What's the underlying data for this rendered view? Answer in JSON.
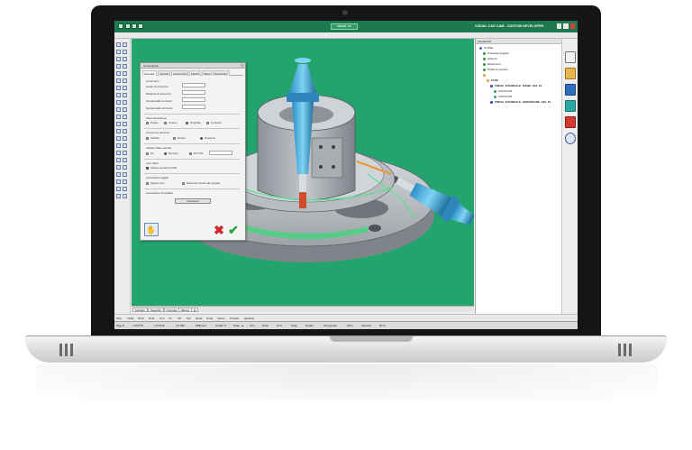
{
  "window": {
    "app_title": "VISUAL CAD CAM - CUSTOM DEVELOPER",
    "logo_text": "VISUAL CC"
  },
  "dialog": {
    "title": "Contornitura",
    "tabs": [
      "Generale",
      "Utensile",
      "Contornitura",
      "Attacco",
      "Stacco",
      "Descrizione"
    ],
    "fields": [
      {
        "label": "Incremento",
        "value": ""
      },
      {
        "label": "Livello di sicurezza",
        "value": ""
      },
      {
        "label": "Distanza di sicurezza",
        "value": ""
      },
      {
        "label": "Sovrametallo sui bordi",
        "value": ""
      },
      {
        "label": "Sovrametallo sul fondo",
        "value": ""
      }
    ],
    "groups": [
      {
        "title": "Verso lavorazione",
        "options": [
          "Diretto",
          "Inverso",
          "Originale",
          "Contrario"
        ],
        "selected": "Originale"
      },
      {
        "title": "Correzione percorso",
        "options": [
          "Sinistra",
          "Destra",
          "Nessuna"
        ],
        "selected": "Nessuna"
      },
      {
        "title": "Calcolo offset utensile",
        "options": [
          "No",
          "Da Cam",
          "Da CNC"
        ],
        "selected": "Da Cam"
      }
    ],
    "auto_tool_label": "Auto offset",
    "check_label": "Allinea contorno profile",
    "group4_title": "Lavorazione spigoli",
    "group4_options": [
      "Spigolo vivo",
      "Raccordo intorno allo spigolo"
    ],
    "group4_selected": "Spigolo vivo",
    "group5_title": "Lavorazione Trocoidale",
    "params_button": "Parametri"
  },
  "tree": {
    "header": "VisualCAM",
    "items": [
      {
        "label": "CLOSE",
        "color": "#3a6fd8",
        "indent": 4,
        "bold": false
      },
      {
        "label": "Proprietà progetto",
        "color": "#2f9a3e",
        "indent": 8,
        "bold": false
      },
      {
        "label": "Attrezzo",
        "color": "#2f9a3e",
        "indent": 8,
        "bold": false
      },
      {
        "label": "Riposizioni",
        "color": "#2f9a3e",
        "indent": 8,
        "bold": false
      },
      {
        "label": "Profilo di sezione",
        "color": "#2f9a3e",
        "indent": 8,
        "bold": false
      },
      {
        "label": "",
        "color": "#d8a21e",
        "indent": 8,
        "bold": false
      },
      {
        "label": "FASE",
        "color": "#d8a21e",
        "indent": 12,
        "bold": true
      },
      {
        "label": "FRESA_EUCIDEALE_PIANE_H16_12",
        "color": "#3a3fb8",
        "indent": 16,
        "bold": true
      },
      {
        "label": "CONTOUR",
        "color": "#2aa56a",
        "indent": 20,
        "bold": false
      },
      {
        "label": "CONTOUR",
        "color": "#2aa56a",
        "indent": 20,
        "bold": false
      },
      {
        "label": "FRESA_EUCIDEALE_SGROSSARE_H10_10",
        "color": "#3a3fb8",
        "indent": 16,
        "bold": true
      }
    ]
  },
  "bottom_tabs": [
    "Modello",
    "Superfici",
    "Formula",
    "Misure",
    "Ω"
  ],
  "command_bar": [
    "Pias",
    "Visita",
    "Punti",
    "Nodi",
    "Cen",
    "Int",
    "Tan",
    "Tan",
    "Quad",
    "Nodo",
    "Vertex",
    "Proietto",
    "Quantity"
  ],
  "status_bar": [
    "Pigg 8",
    "x:40.578",
    "y:54.546",
    "z:0.000",
    "Millimetri",
    "Griglia: 5'",
    "Snap: ▲",
    "Orto",
    "Polar",
    "Grid",
    "Snap",
    "Griglia",
    "Ortogonale",
    "Filtro",
    "Velocita",
    "80 %"
  ],
  "colors": {
    "titlebar": "#1d7a4f",
    "viewport": "#23a46c",
    "accent_red": "#d2262a",
    "accent_green": "#27a33a"
  }
}
